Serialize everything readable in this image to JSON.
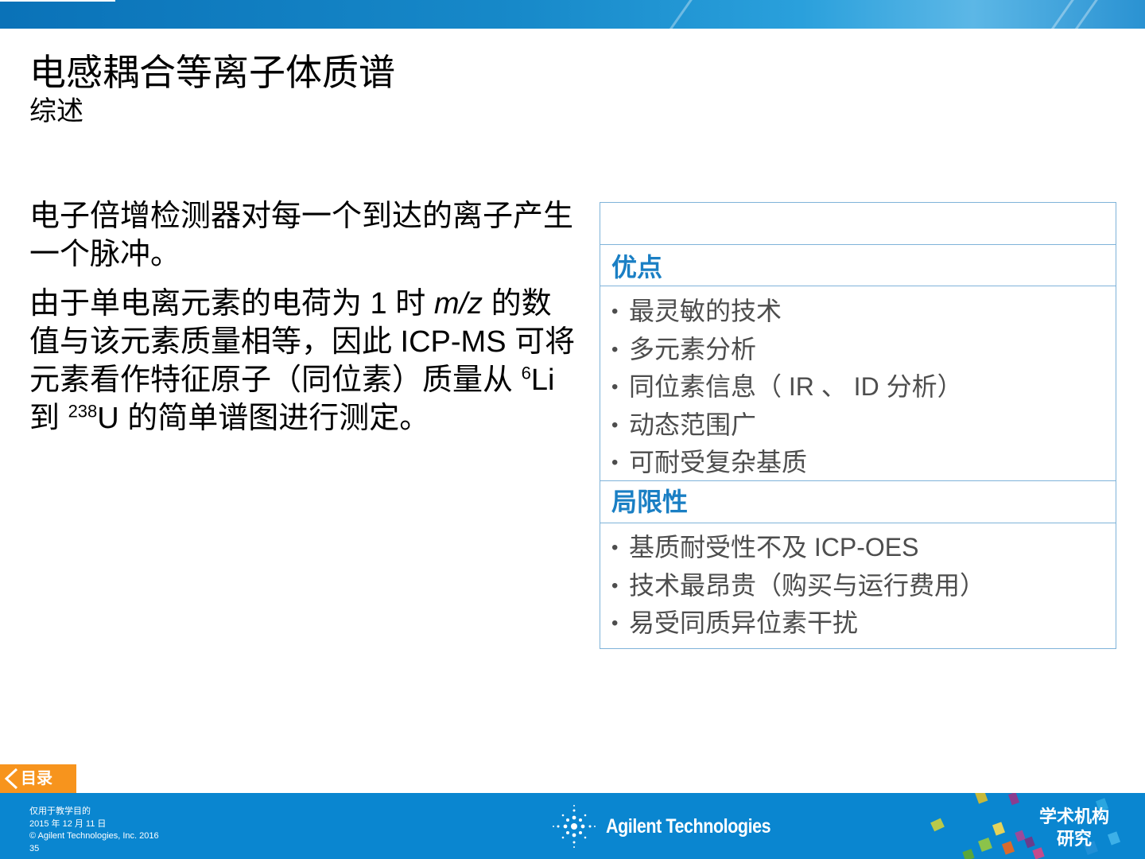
{
  "slide": {
    "title": "电感耦合等离子体质谱",
    "subtitle": "综述"
  },
  "body": {
    "para1": "电子倍增检测器对每一个到达的离子产生一个脉冲。",
    "para2": {
      "p1": "由于单电离元素的电荷为  1  时  ",
      "mz": "m/z",
      "p2": " 的数值与该元素质量相等，因此  ICP-MS  可将元素看作特征原子（同位素）质量从  ",
      "sup1": "6",
      "p3": "Li  到  ",
      "sup2": "238",
      "p4": "U  的简单谱图进行测定。"
    }
  },
  "panel": {
    "advantages_heading": "优点",
    "advantages": [
      "最灵敏的技术",
      "多元素分析",
      "同位素信息（ IR 、 ID  分析）",
      "动态范围广",
      "可耐受复杂基质"
    ],
    "limitations_heading": "局限性",
    "limitations": [
      "基质耐受性不及  ICP-OES",
      "技术最昂贵（购买与运行费用）",
      "易受同质异位素干扰"
    ]
  },
  "nav": {
    "toc_label": "目录"
  },
  "footer": {
    "line1": "仅用于教学目的",
    "line2": "2015 年 12 月 11 日",
    "line3": "© Agilent Technologies, Inc. 2016",
    "page_number": "35",
    "brand": "Agilent Technologies",
    "institute_line1": "学术机构",
    "institute_line2": "研究"
  },
  "colors": {
    "brand_blue": "#0a86d0",
    "heading_blue": "#1a7fc4",
    "toc_orange": "#f7941d"
  }
}
